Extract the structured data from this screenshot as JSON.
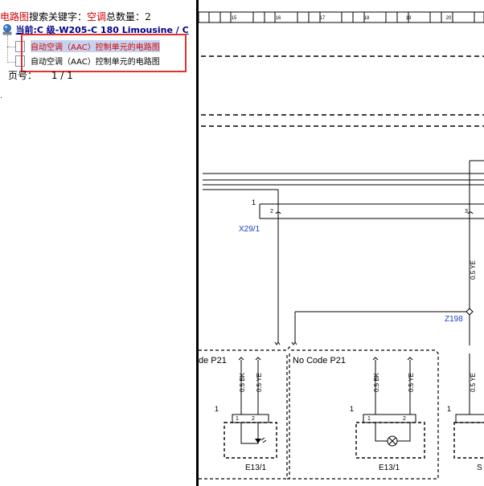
{
  "search": {
    "label": "电路图",
    "keyword_label": "搜索关键字：",
    "keyword": "空调",
    "count_label": "总数量：",
    "count": "2"
  },
  "current": {
    "text": "当前:C 级-W205-C 180 Limousine / C"
  },
  "results": [
    {
      "label": "自动空调（AAC）控制单元的电路图"
    },
    {
      "label": "自动空调（AAC）控制单元的电路图"
    }
  ],
  "pager": {
    "label": "页号：",
    "value": "1 / 1"
  },
  "link_mark": ".",
  "diagram": {
    "columns": [
      "15",
      "16",
      "17",
      "18",
      "19",
      "20"
    ],
    "labels": {
      "pin1_top": "1",
      "pin2": "2",
      "pin3": "3",
      "x29": "X29/1",
      "wire_ye_top": "0.5 YE",
      "z198": "Z198",
      "code_left": "de P21",
      "code_right": "No Code P21",
      "bk_left": "0.5 BK",
      "ye_left": "0.5 YE",
      "bk_right": "0.5 BK",
      "ye_right": "0.5 YE",
      "ye_far": "0.5 YE",
      "one_a": "1",
      "one_b": "1",
      "one_c": "1",
      "c1a": "1",
      "c2a": "2",
      "c1b": "1",
      "c2b": "2",
      "e13a": "E13/1",
      "e13b": "E13/1",
      "s_cut": "S"
    }
  }
}
